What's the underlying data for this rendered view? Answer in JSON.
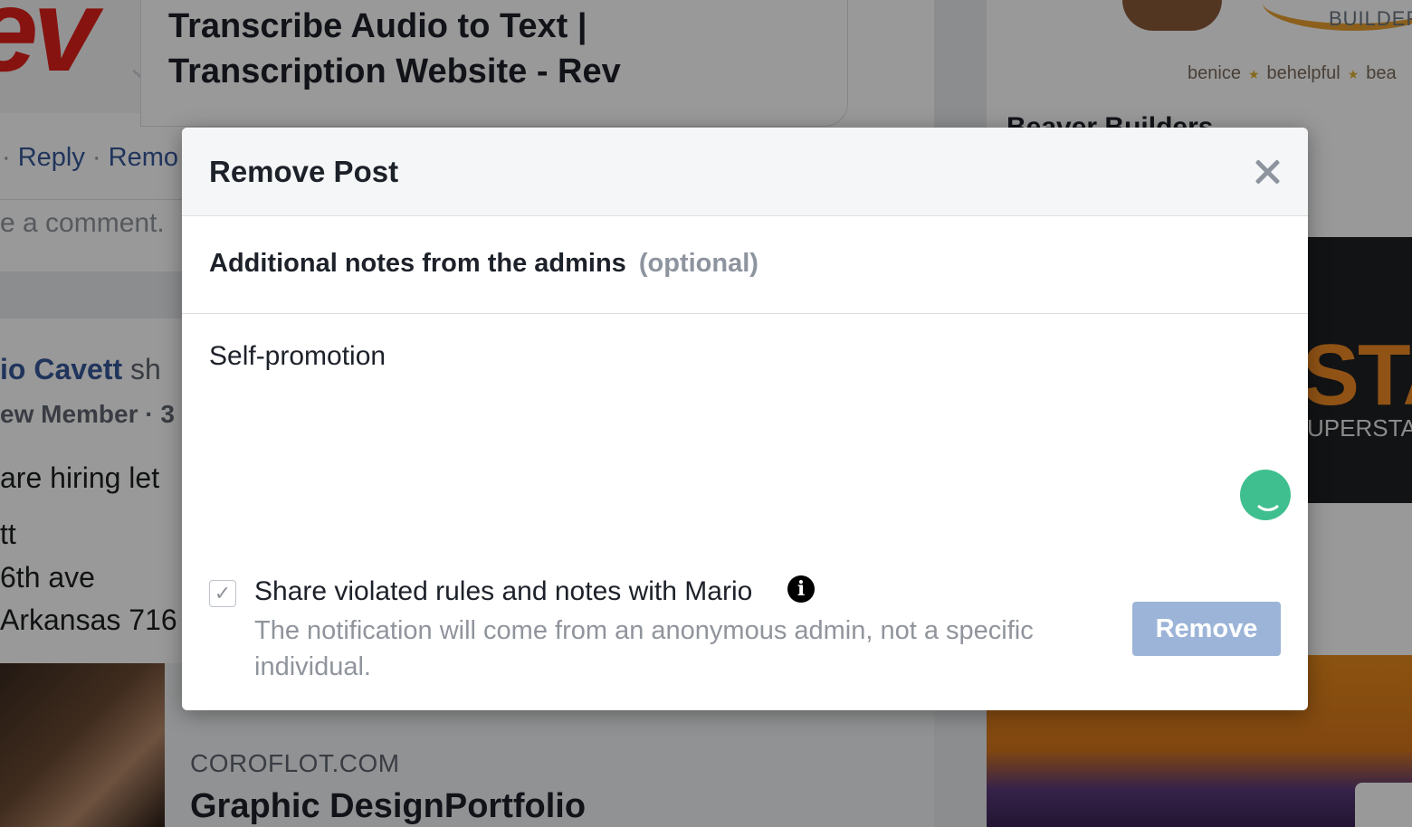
{
  "background": {
    "link_title": "Transcribe Audio to Text | Transcription Website - Rev",
    "actions": [
      "Reply",
      "Remo"
    ],
    "comment_placeholder": "e a comment.",
    "poster_name": "io Cavett",
    "poster_rest": "sh",
    "member_label": "ew Member · 3",
    "post_lines": [
      "are hiring let",
      "tt",
      "6th ave",
      "Arkansas 716"
    ],
    "link_domain": "COROFLOT.COM",
    "link_card_title": "Graphic DesignPortfolio",
    "builder_word": "BUILDER",
    "tags": [
      "benice",
      "behelpful",
      "bea"
    ],
    "builders_title": "Beaver Builders",
    "ad_word": "STAR",
    "ad_subword": "UPERSTARS"
  },
  "modal": {
    "title": "Remove Post",
    "notes_label": "Additional notes from the admins",
    "notes_optional": "(optional)",
    "notes_value": "Self-promotion",
    "share_checked": true,
    "share_label": "Share violated rules and notes with Mario",
    "share_description": "The notification will come from an anonymous admin, not a specific individual.",
    "remove_label": "Remove",
    "colors": {
      "remove_button": "#9cb4d8",
      "header_bg": "#f5f6f7",
      "muted_text": "#8d949e",
      "grammarly": "#3fbf8f"
    },
    "icons": [
      "close-icon",
      "info-icon",
      "check-icon",
      "grammarly-icon"
    ]
  }
}
